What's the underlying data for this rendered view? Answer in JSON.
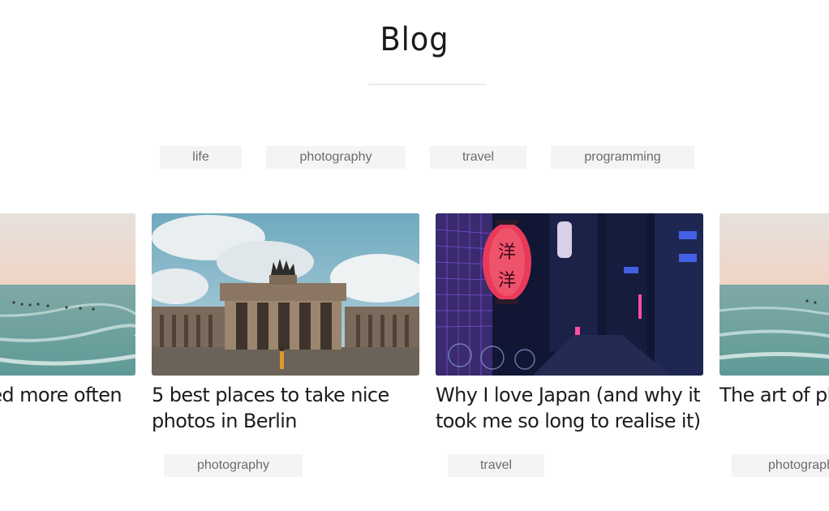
{
  "header": {
    "title": "Blog"
  },
  "filters": [
    {
      "label": "life"
    },
    {
      "label": "photography"
    },
    {
      "label": "travel"
    },
    {
      "label": "programming"
    }
  ],
  "cards": [
    {
      "title": "red more often",
      "tag": "",
      "image": "ocean-shore-image"
    },
    {
      "title": "5 best places to take nice photos in Berlin",
      "tag": "photography",
      "image": "brandenburg-gate-image"
    },
    {
      "title": "Why I love Japan (and why it took me so long to realise it)",
      "tag": "travel",
      "image": "tokyo-night-street-image"
    },
    {
      "title": "The art of pho",
      "tag": "photograph",
      "image": "ocean-shore-image"
    }
  ]
}
